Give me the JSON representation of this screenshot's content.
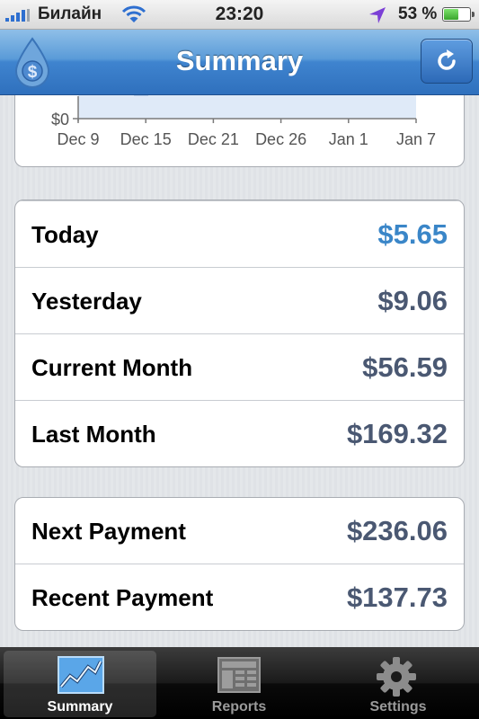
{
  "status_bar": {
    "carrier": "Билайн",
    "time": "23:20",
    "battery_percent": "53 %",
    "battery_level": 0.53,
    "signal_bars": 4
  },
  "nav": {
    "title": "Summary",
    "logo_icon": "dollar-drop-icon",
    "refresh_icon": "refresh-icon"
  },
  "chart_data": {
    "type": "area",
    "y_tick_labels": [
      "$0"
    ],
    "x_tick_labels": [
      "Dec 9",
      "Dec 15",
      "Dec 21",
      "Dec 26",
      "Jan 1",
      "Jan 7"
    ],
    "fill_color": "#dfeaf8"
  },
  "earnings": [
    {
      "label": "Today",
      "value": "$5.65",
      "highlight": true
    },
    {
      "label": "Yesterday",
      "value": "$9.06",
      "highlight": false
    },
    {
      "label": "Current Month",
      "value": "$56.59",
      "highlight": false
    },
    {
      "label": "Last Month",
      "value": "$169.32",
      "highlight": false
    }
  ],
  "payments": [
    {
      "label": "Next Payment",
      "value": "$236.06"
    },
    {
      "label": "Recent Payment",
      "value": "$137.73"
    }
  ],
  "colors": {
    "highlight_value": "#3a86c8",
    "value": "#4a5872",
    "nav_blue": "#3f84cf"
  },
  "tabs": [
    {
      "label": "Summary",
      "icon": "line-chart-icon",
      "active": true
    },
    {
      "label": "Reports",
      "icon": "newspaper-icon",
      "active": false
    },
    {
      "label": "Settings",
      "icon": "gear-icon",
      "active": false
    }
  ]
}
